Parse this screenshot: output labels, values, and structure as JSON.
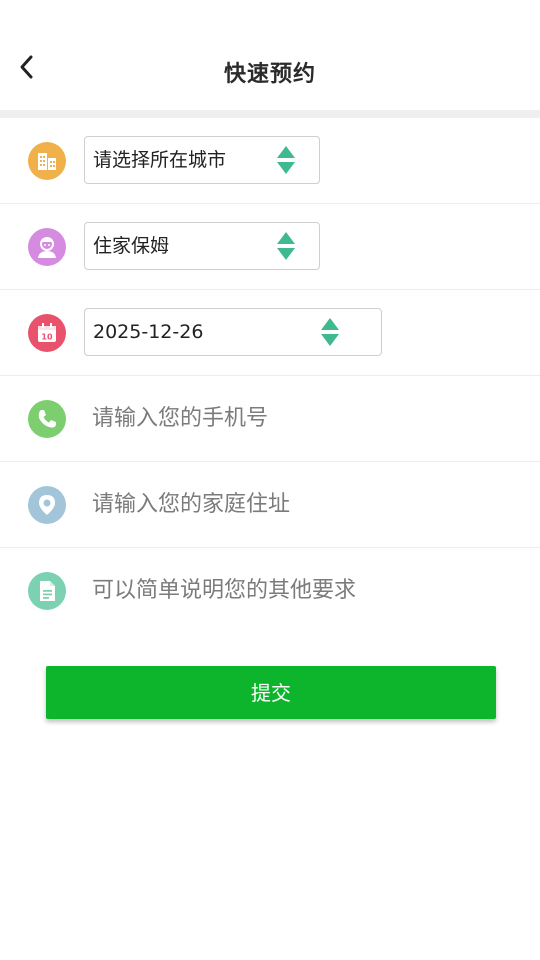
{
  "header": {
    "title": "快速预约",
    "back_icon": "chevron-left-icon"
  },
  "form": {
    "city": {
      "value": "请选择所在城市",
      "icon": "building-icon",
      "color": "#f0b04a"
    },
    "service": {
      "value": "住家保姆",
      "icon": "nanny-icon",
      "color": "#d48be0"
    },
    "date": {
      "value": "2025-12-26",
      "icon": "calendar-icon",
      "color": "#e9526c",
      "icon_text": "10"
    },
    "phone": {
      "placeholder": "请输入您的手机号",
      "icon": "phone-icon",
      "color": "#7dce6e"
    },
    "address": {
      "placeholder": "请输入您的家庭住址",
      "icon": "location-pin-icon",
      "color": "#a3c5d9"
    },
    "notes": {
      "placeholder": "可以简单说明您的其他要求",
      "icon": "document-icon",
      "color": "#7bd1b2"
    }
  },
  "submit": {
    "label": "提交",
    "color": "#0db52c"
  },
  "colors": {
    "spinner": "#3fba8e",
    "divider": "#efefef"
  }
}
